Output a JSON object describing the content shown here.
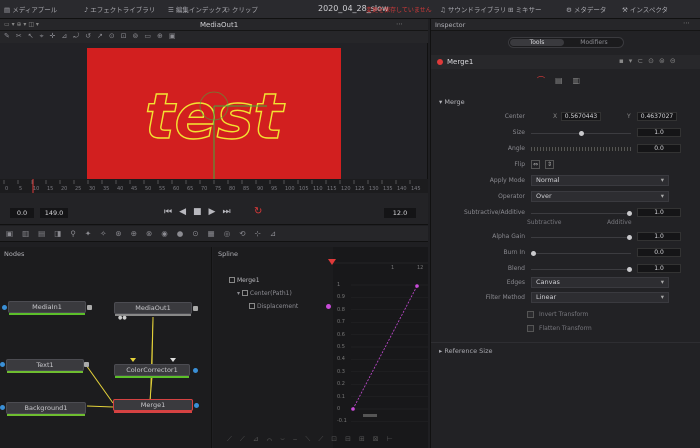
{
  "topbar": {
    "items": [
      "メディアプール",
      "エフェクトライブラリ",
      "編集インデックス",
      "クリップ",
      "サウンドライブラリ",
      "ミキサー",
      "メタデータ",
      "インスペクタ"
    ],
    "project_title": "2020_04_28_slow",
    "project_subtitle": "変更を保存していません",
    "sound_label": "サウンドライブラリ"
  },
  "viewer": {
    "title": "MediaOut1",
    "zoom": "",
    "canvas_text": "test",
    "timeline_ticks": [
      "0",
      "5",
      "10",
      "15",
      "20",
      "25",
      "30",
      "35",
      "40",
      "45",
      "50",
      "55",
      "60",
      "65",
      "70",
      "75",
      "80",
      "85",
      "90",
      "95",
      "100",
      "105",
      "110",
      "115",
      "120",
      "125",
      "130",
      "135",
      "140",
      "145"
    ],
    "start_value": "0.0",
    "end_value": "149.0",
    "current_frame": "12.0",
    "colors": {
      "canvas": "#d21f1f",
      "text_stroke": "#f2e332"
    }
  },
  "nodes_panel": {
    "title": "Nodes",
    "nodes": [
      {
        "label": "MediaIn1"
      },
      {
        "label": "MediaOut1"
      },
      {
        "label": "Text1"
      },
      {
        "label": "ColorCorrector1"
      },
      {
        "label": "Background1"
      },
      {
        "label": "Merge1"
      }
    ]
  },
  "spline_panel": {
    "title": "Spline",
    "tree": [
      "Merge1",
      "Center(Path1)",
      "Displacement"
    ],
    "y_ticks": [
      "1",
      "0.9",
      "0.8",
      "0.7",
      "0.6",
      "0.5",
      "0.4",
      "0.3",
      "0.2",
      "0.1",
      "0",
      "-0.1"
    ],
    "x_ticks": [
      "1",
      "12"
    ]
  },
  "inspector": {
    "title": "Inspector",
    "tabs": [
      "Tools",
      "Modifiers"
    ],
    "node_name": "Merge1",
    "section": "Merge",
    "center_x_label": "X",
    "center_x": "0.5670443",
    "center_y_label": "Y",
    "center_y": "0.4637027",
    "rows": [
      {
        "label": "Center"
      },
      {
        "label": "Size",
        "value": "1.0",
        "level": 0.5
      },
      {
        "label": "Angle",
        "value": "0.0"
      },
      {
        "label": "Flip"
      },
      {
        "label": "Apply Mode",
        "select": "Normal"
      },
      {
        "label": "Operator",
        "select": "Over"
      },
      {
        "label": "Subtractive/Additive",
        "value": "1.0",
        "level": 1.0
      },
      {
        "label": "Alpha Gain",
        "value": "1.0",
        "level": 1.0
      },
      {
        "label": "Burn In",
        "value": "0.0",
        "level": 0.0
      },
      {
        "label": "Blend",
        "value": "1.0",
        "level": 1.0
      },
      {
        "label": "Edges",
        "select": "Canvas"
      },
      {
        "label": "Filter Method",
        "select": "Linear"
      }
    ],
    "subtractive_label": "Subtractive",
    "additive_label": "Additive",
    "invert_label": "Invert Transform",
    "flatten_label": "Flatten Transform",
    "reference_size": "Reference Size"
  }
}
